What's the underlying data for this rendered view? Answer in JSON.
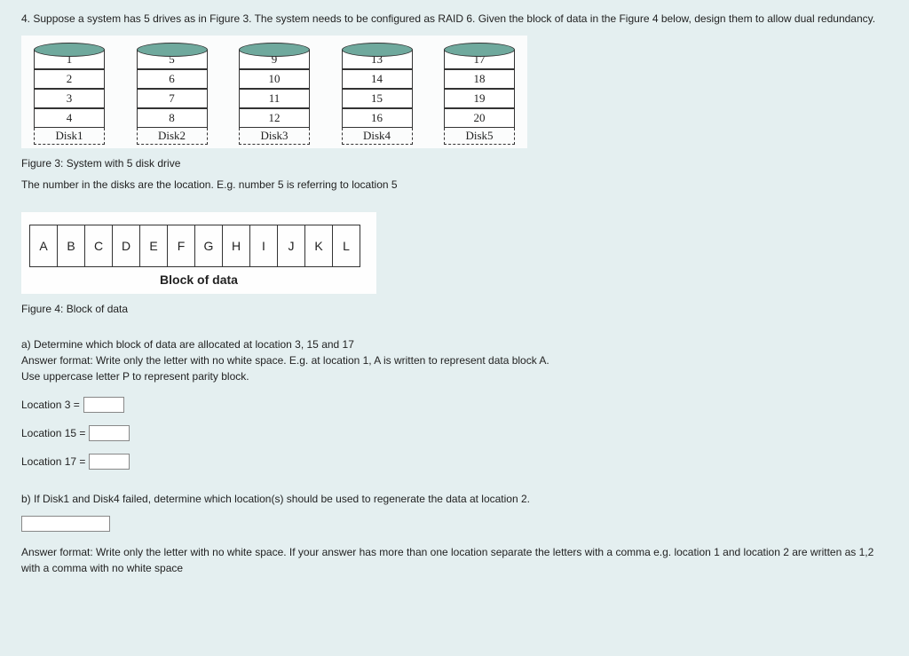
{
  "question_intro": "4. Suppose a system has 5 drives as in Figure 3. The system needs to be configured as RAID 6. Given the block of data in the Figure 4 below, design them to allow dual redundancy.",
  "disks": [
    {
      "label": "Disk1",
      "cells": [
        "1",
        "2",
        "3",
        "4"
      ]
    },
    {
      "label": "Disk2",
      "cells": [
        "5",
        "6",
        "7",
        "8"
      ]
    },
    {
      "label": "Disk3",
      "cells": [
        "9",
        "10",
        "11",
        "12"
      ]
    },
    {
      "label": "Disk4",
      "cells": [
        "13",
        "14",
        "15",
        "16"
      ]
    },
    {
      "label": "Disk5",
      "cells": [
        "17",
        "18",
        "19",
        "20"
      ]
    }
  ],
  "fig3_caption": "Figure 3: System with 5 disk drive",
  "fig3_note": "The number in the disks are the location. E.g. number 5 is referring to location 5",
  "data_blocks": [
    "A",
    "B",
    "C",
    "D",
    "E",
    "F",
    "G",
    "H",
    "I",
    "J",
    "K",
    "L"
  ],
  "block_title": "Block of data",
  "fig4_caption": "Figure 4: Block of data",
  "part_a_q": "a) Determine which block of data are allocated at location 3, 15 and 17",
  "part_a_format": "Answer format: Write only the letter with no white space. E.g. at location 1, A is written to represent data block A.",
  "part_a_hint": "Use uppercase letter P to represent parity block.",
  "ans_labels": {
    "loc3": "Location 3 =",
    "loc15": "Location 15 =",
    "loc17": "Location 17 ="
  },
  "part_b_q": "b) If Disk1 and Disk4 failed, determine which location(s) should be used to regenerate the data at location 2.",
  "part_b_format": "Answer format: Write only the letter with no white space. If your answer has more than one location separate the letters with a comma e.g. location 1 and location 2 are written as 1,2 with a comma with no white space"
}
